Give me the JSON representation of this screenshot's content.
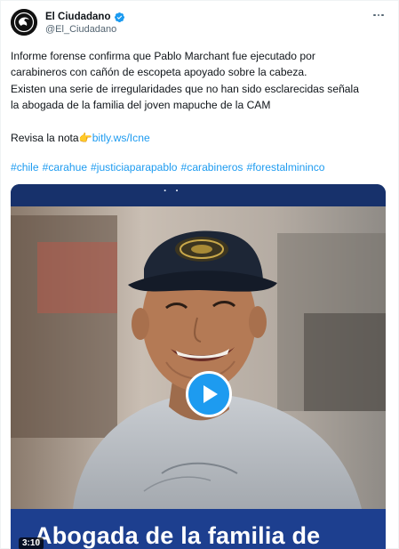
{
  "author": {
    "display_name": "El Ciudadano",
    "handle": "@El_Ciudadano",
    "verified": true,
    "verified_color": "#1d9bf0"
  },
  "more_icon": "more-horizontal-icon",
  "tweet": {
    "line1": "Informe forense confirma que Pablo Marchant fue ejecutado por",
    "line2": "carabineros con cañón de escopeta apoyado sobre la cabeza.",
    "line3": "Existen una serie de irregularidades que no han sido esclarecidas señala",
    "line4": "la abogada de la familia del joven mapuche de la CAM",
    "read_prefix": "Revisa la nota",
    "pointing_emoji": "👉",
    "link_text": "bitly.ws/Icne",
    "hashtags": [
      "#chile",
      "#carahue",
      "#justiciaparapablo",
      "#carabineros",
      "#forestalmininco"
    ]
  },
  "video": {
    "duration": "3:10",
    "banner_text": "Abogada de la familia de",
    "play_icon": "play-icon",
    "accent_color": "#1d9bf0",
    "banner_color": "#1d3f8f"
  }
}
